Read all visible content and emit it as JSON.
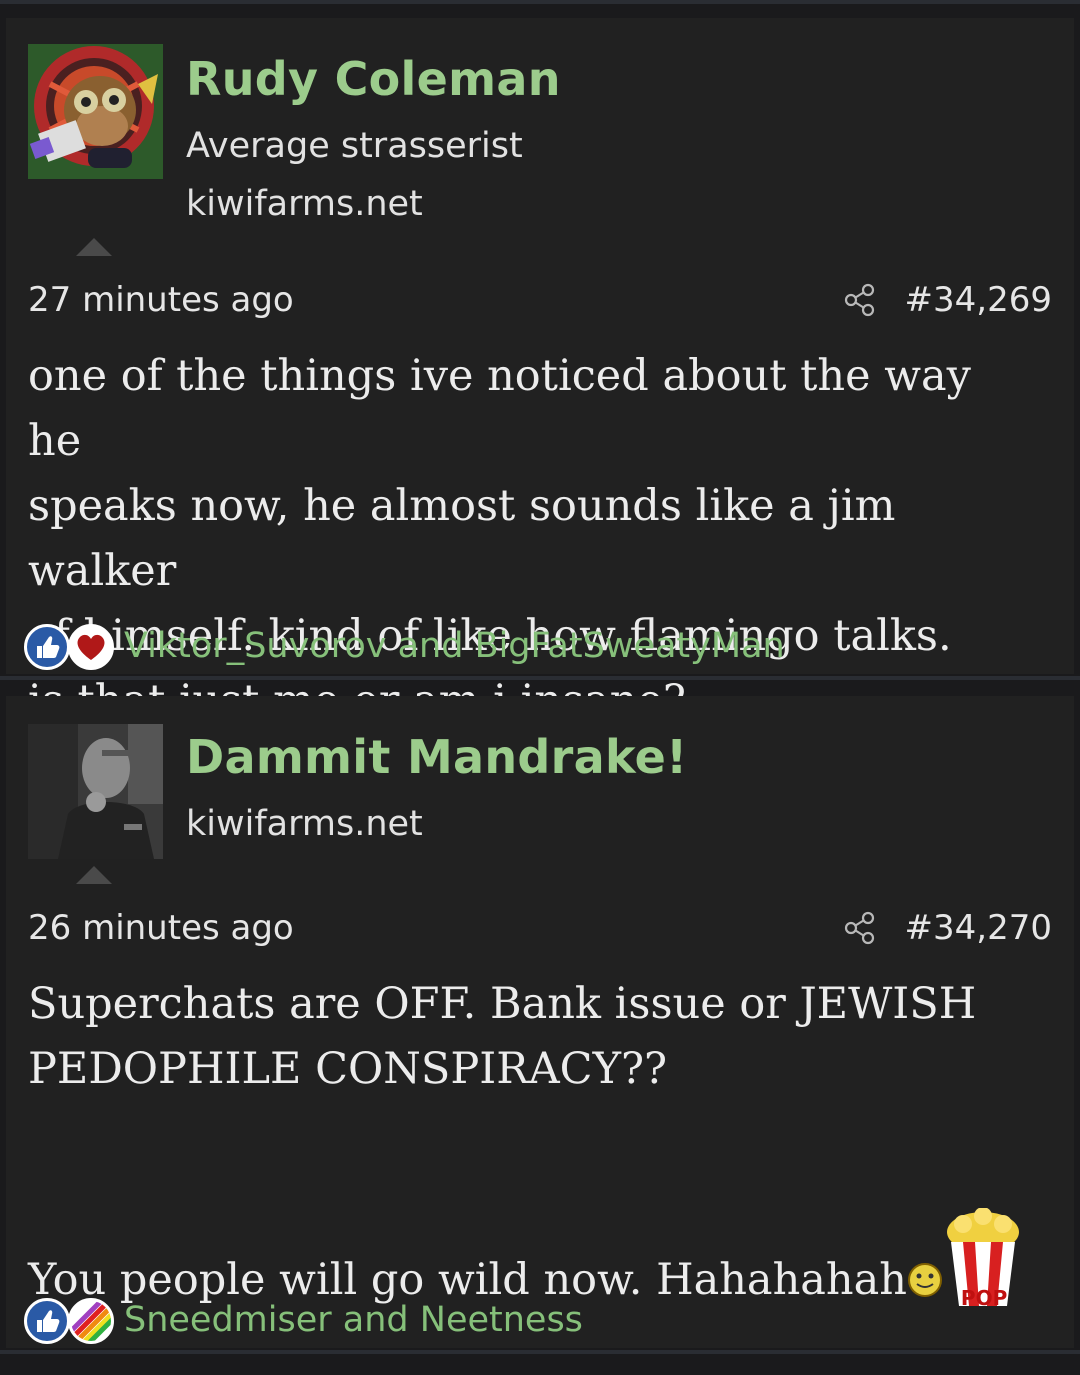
{
  "posts": [
    {
      "username": "Rudy Coleman",
      "user_title": "Average strasserist",
      "site": "kiwifarms.net",
      "timestamp": "27 minutes ago",
      "post_number": "#34,269",
      "body": "one of the things ive noticed about the way he\nspeaks now, he almost sounds like a jim walker\nof himself. kind of like how flamingo talks.\nis that just me or am i insane?",
      "reactions_text": "Viktor_Suvorov and BigFatSweatyMan",
      "reaction_icons": [
        "like-icon",
        "heart-icon"
      ]
    },
    {
      "username": "Dammit Mandrake!",
      "site": "kiwifarms.net",
      "timestamp": "26 minutes ago",
      "post_number": "#34,270",
      "body_line1": "Superchats are OFF. Bank issue or JEWISH\nPEDOPHILE CONSPIRACY??",
      "body_line2": "You people will go wild now. Hahahahah",
      "emoji_icons": [
        "popcorn-smiley-icon",
        "popcorn-bucket-icon"
      ],
      "popcorn_label": "POP",
      "reactions_text": "Sneedmiser and Neetness",
      "reaction_icons": [
        "like-icon",
        "rainbow-icon"
      ]
    }
  ],
  "colors": {
    "username": "#9ccc8c",
    "reactions_text": "#86c07a",
    "background": "#212121"
  }
}
